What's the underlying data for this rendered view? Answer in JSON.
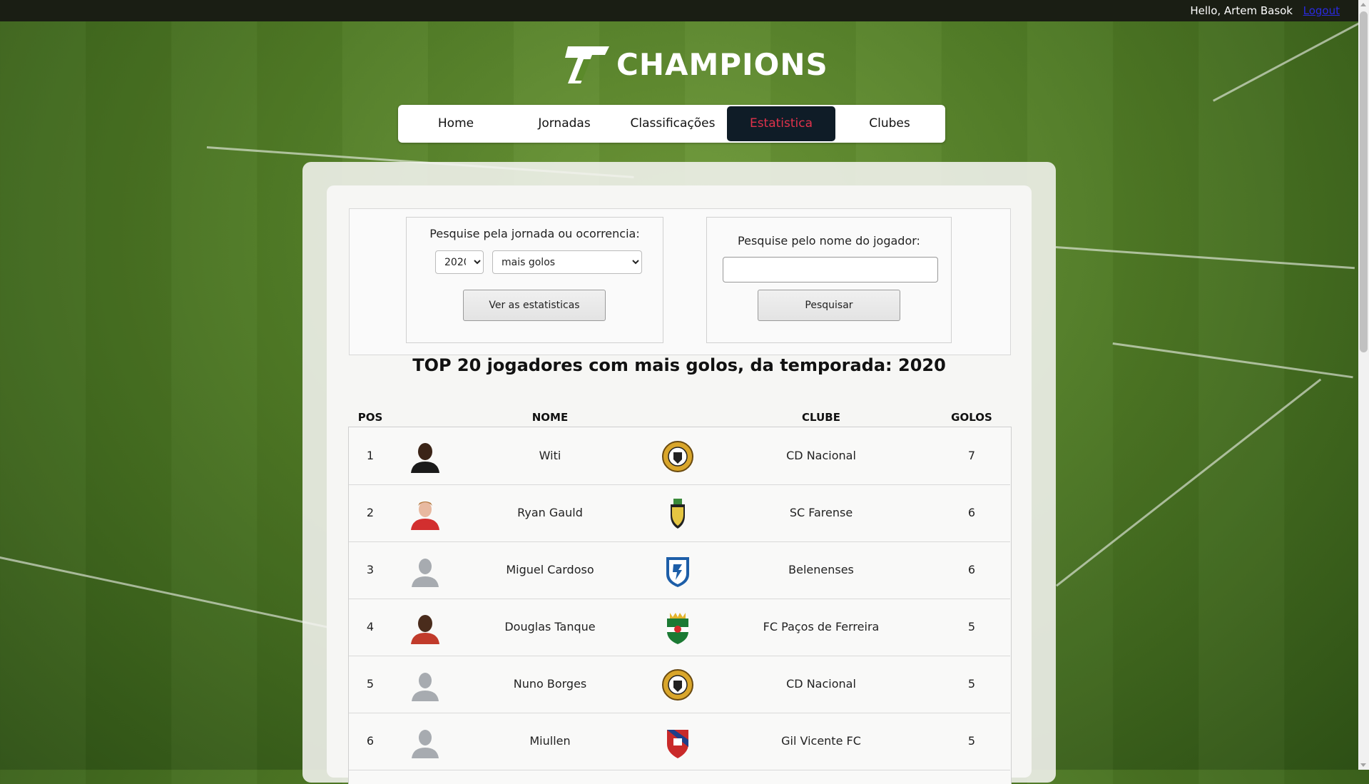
{
  "topbar": {
    "greeting": "Hello, Artem Basok",
    "logout": "Logout"
  },
  "brand": {
    "name": "CHAMPIONS"
  },
  "nav": [
    {
      "label": "Home",
      "active": false
    },
    {
      "label": "Jornadas",
      "active": false
    },
    {
      "label": "Classificações",
      "active": false
    },
    {
      "label": "Estatistica",
      "active": true
    },
    {
      "label": "Clubes",
      "active": false
    }
  ],
  "search_round": {
    "label": "Pesquise pela jornada ou ocorrencia:",
    "season_selected": "2020",
    "stat_selected": "mais golos",
    "button": "Ver as estatisticas"
  },
  "search_player": {
    "label": "Pesquise pelo nome do jogador:",
    "input_value": "",
    "button": "Pesquisar"
  },
  "title": "TOP 20 jogadores com mais golos, da temporada: 2020",
  "table": {
    "headers": {
      "pos": "POS",
      "nome": "NOME",
      "clube": "CLUBE",
      "golos": "GOLOS"
    },
    "rows": [
      {
        "pos": "1",
        "nome": "Witi",
        "clube": "CD Nacional",
        "golos": "7"
      },
      {
        "pos": "2",
        "nome": "Ryan Gauld",
        "clube": "SC Farense",
        "golos": "6"
      },
      {
        "pos": "3",
        "nome": "Miguel Cardoso",
        "clube": "Belenenses",
        "golos": "6"
      },
      {
        "pos": "4",
        "nome": "Douglas Tanque",
        "clube": "FC Paços de Ferreira",
        "golos": "5"
      },
      {
        "pos": "5",
        "nome": "Nuno Borges",
        "clube": "CD Nacional",
        "golos": "5"
      },
      {
        "pos": "6",
        "nome": "Miullen",
        "clube": "Gil Vicente FC",
        "golos": "5"
      }
    ]
  }
}
